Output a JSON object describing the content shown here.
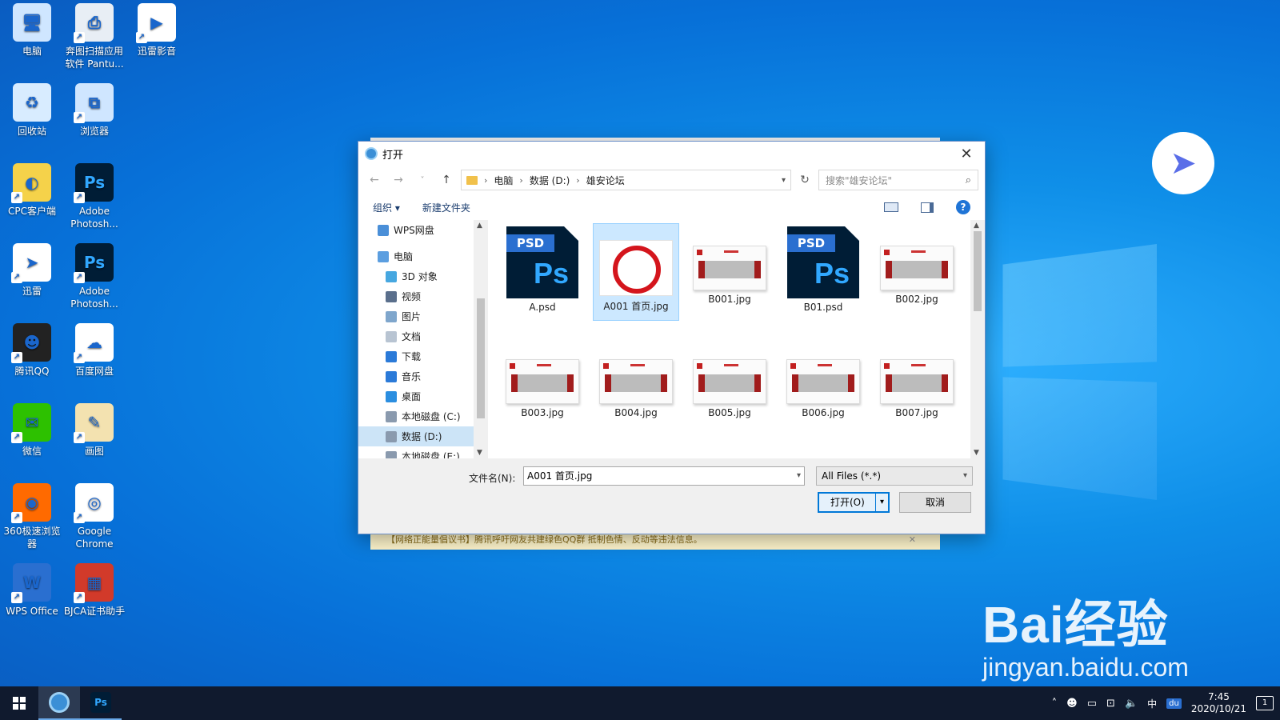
{
  "desktop": {
    "icons": [
      {
        "label": "电脑",
        "icon": "computer-icon",
        "color": "#cfe6ff",
        "glyph": "🖥"
      },
      {
        "label": "奔图扫描应用软件 Pantu...",
        "icon": "scanner-icon",
        "color": "#e8eef5",
        "glyph": "⎙"
      },
      {
        "label": "迅雷影音",
        "icon": "xunlei-player-icon",
        "color": "#ffffff",
        "glyph": "▶"
      },
      {
        "label": "回收站",
        "icon": "recycle-bin-icon",
        "color": "#d8ecff",
        "glyph": "♻"
      },
      {
        "label": "浏览器",
        "icon": "browser-icon",
        "color": "#cfe6ff",
        "glyph": "⧉"
      },
      {
        "label": "CPC客户端",
        "icon": "cpc-client-icon",
        "color": "#f5d24a",
        "glyph": "◐"
      },
      {
        "label": "Adobe Photosh...",
        "icon": "photoshop-icon",
        "color": "#001d36",
        "glyph": "Ps"
      },
      {
        "label": "迅雷",
        "icon": "xunlei-icon",
        "color": "#ffffff",
        "glyph": "➤"
      },
      {
        "label": "Adobe Photosh...",
        "icon": "photoshop-icon",
        "color": "#001d36",
        "glyph": "Ps"
      },
      {
        "label": "腾讯QQ",
        "icon": "qq-icon",
        "color": "#222222",
        "glyph": "☻"
      },
      {
        "label": "百度网盘",
        "icon": "baidu-netdisk-icon",
        "color": "#ffffff",
        "glyph": "☁"
      },
      {
        "label": "微信",
        "icon": "wechat-icon",
        "color": "#2dc100",
        "glyph": "✉"
      },
      {
        "label": "画图",
        "icon": "paint-icon",
        "color": "#f3e2b0",
        "glyph": "✎"
      },
      {
        "label": "360极速浏览器",
        "icon": "360-browser-icon",
        "color": "#ff6a00",
        "glyph": "◉"
      },
      {
        "label": "Google Chrome",
        "icon": "chrome-icon",
        "color": "#ffffff",
        "glyph": "◎"
      },
      {
        "label": "WPS Office",
        "icon": "wps-office-icon",
        "color": "#2a6fd0",
        "glyph": "W"
      },
      {
        "label": "BJCA证书助手",
        "icon": "bjca-cert-icon",
        "color": "#d23a2a",
        "glyph": "▦"
      }
    ]
  },
  "background_window": {
    "banner_text": "【网络正能量倡议书】腾讯呼吁网友共建绿色QQ群 抵制色情、反动等违法信息。"
  },
  "watermark": {
    "brand": "Bai经验",
    "url": "jingyan.baidu.com"
  },
  "dialog": {
    "title": "打开",
    "breadcrumb": [
      "电脑",
      "数据 (D:)",
      "雄安论坛"
    ],
    "search_placeholder": "搜索\"雄安论坛\"",
    "toolbar": {
      "organize": "组织 ▾",
      "new_folder": "新建文件夹"
    },
    "nav_items": [
      {
        "label": "WPS网盘",
        "icon": "cloud-icon",
        "color": "#4a8fd8",
        "level": 1
      },
      {
        "label": "电脑",
        "icon": "computer-icon",
        "color": "#5b9ee0",
        "level": 1
      },
      {
        "label": "3D 对象",
        "icon": "3d-objects-icon",
        "color": "#46a7e0",
        "level": 2
      },
      {
        "label": "视频",
        "icon": "video-icon",
        "color": "#5a6f8c",
        "level": 2
      },
      {
        "label": "图片",
        "icon": "pictures-icon",
        "color": "#7fa6cc",
        "level": 2
      },
      {
        "label": "文档",
        "icon": "documents-icon",
        "color": "#b8c4d2",
        "level": 2
      },
      {
        "label": "下载",
        "icon": "download-icon",
        "color": "#2b7ad8",
        "level": 2
      },
      {
        "label": "音乐",
        "icon": "music-icon",
        "color": "#2b7ad8",
        "level": 2
      },
      {
        "label": "桌面",
        "icon": "desktop-icon",
        "color": "#2b8ee0",
        "level": 2
      },
      {
        "label": "本地磁盘 (C:)",
        "icon": "drive-icon",
        "color": "#8a9aae",
        "level": 2
      },
      {
        "label": "数据 (D:)",
        "icon": "drive-icon",
        "color": "#8a9aae",
        "level": 2,
        "selected": true
      },
      {
        "label": "本地磁盘 (E:)",
        "icon": "drive-icon",
        "color": "#8a9aae",
        "level": 2
      }
    ],
    "files": [
      {
        "name": "A.psd",
        "kind": "psd"
      },
      {
        "name": "A001 首页.jpg",
        "kind": "selected"
      },
      {
        "name": "B001.jpg",
        "kind": "jpg"
      },
      {
        "name": "B01.psd",
        "kind": "psd"
      },
      {
        "name": "B002.jpg",
        "kind": "jpg"
      },
      {
        "name": "B003.jpg",
        "kind": "jpg"
      },
      {
        "name": "B004.jpg",
        "kind": "jpg"
      },
      {
        "name": "B005.jpg",
        "kind": "jpg"
      },
      {
        "name": "B006.jpg",
        "kind": "jpg"
      },
      {
        "name": "B007.jpg",
        "kind": "jpg"
      }
    ],
    "filename_label": "文件名(N):",
    "filename_value": "A001 首页.jpg",
    "filetype_value": "All Files (*.*)",
    "open_label": "打开(O)",
    "cancel_label": "取消"
  },
  "taskbar": {
    "clock_time": "7:45",
    "clock_date": "2020/10/21",
    "ime": "中",
    "notification_count": "1"
  }
}
